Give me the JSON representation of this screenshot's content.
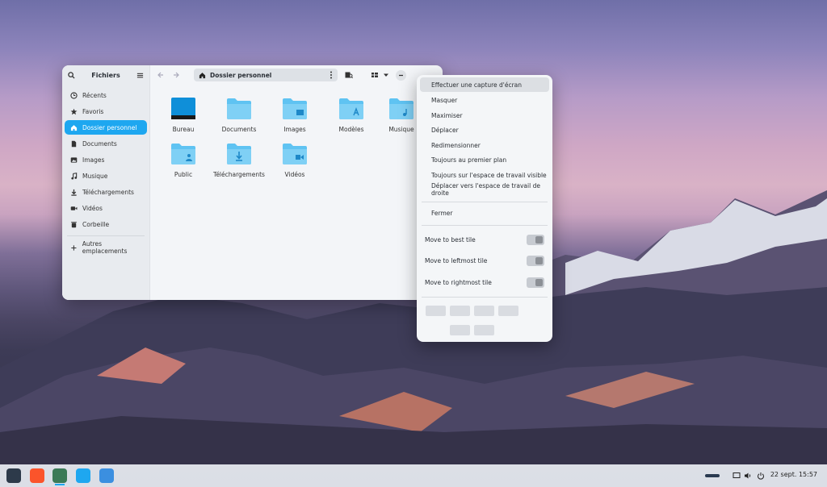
{
  "window": {
    "sidebar_title": "Fichiers",
    "path_label": "Dossier personnel",
    "sidebar_items": [
      {
        "label": "Récents",
        "icon": "clock-icon"
      },
      {
        "label": "Favoris",
        "icon": "star-icon"
      },
      {
        "label": "Dossier personnel",
        "icon": "home-icon"
      },
      {
        "label": "Documents",
        "icon": "document-icon"
      },
      {
        "label": "Images",
        "icon": "image-icon"
      },
      {
        "label": "Musique",
        "icon": "music-icon"
      },
      {
        "label": "Téléchargements",
        "icon": "download-icon"
      },
      {
        "label": "Vidéos",
        "icon": "video-icon"
      },
      {
        "label": "Corbeille",
        "icon": "trash-icon"
      }
    ],
    "other_locations": "Autres emplacements",
    "files": [
      {
        "label": "Bureau"
      },
      {
        "label": "Documents"
      },
      {
        "label": "Images"
      },
      {
        "label": "Modèles"
      },
      {
        "label": "Musique"
      },
      {
        "label": "Public"
      },
      {
        "label": "Téléchargements"
      },
      {
        "label": "Vidéos"
      }
    ]
  },
  "menu": {
    "items": [
      "Effectuer une capture d'écran",
      "Masquer",
      "Maximiser",
      "Déplacer",
      "Redimensionner",
      "Toujours au premier plan",
      "Toujours sur l'espace de travail visible",
      "Déplacer vers l'espace de travail de droite"
    ],
    "close": "Fermer",
    "toggles": [
      "Move to best tile",
      "Move to leftmost tile",
      "Move to rightmost tile"
    ]
  },
  "taskbar": {
    "clock": "22 sept.  15:57"
  },
  "colors": {
    "accent": "#1ea7f0",
    "folder": "#5fc3f2"
  }
}
